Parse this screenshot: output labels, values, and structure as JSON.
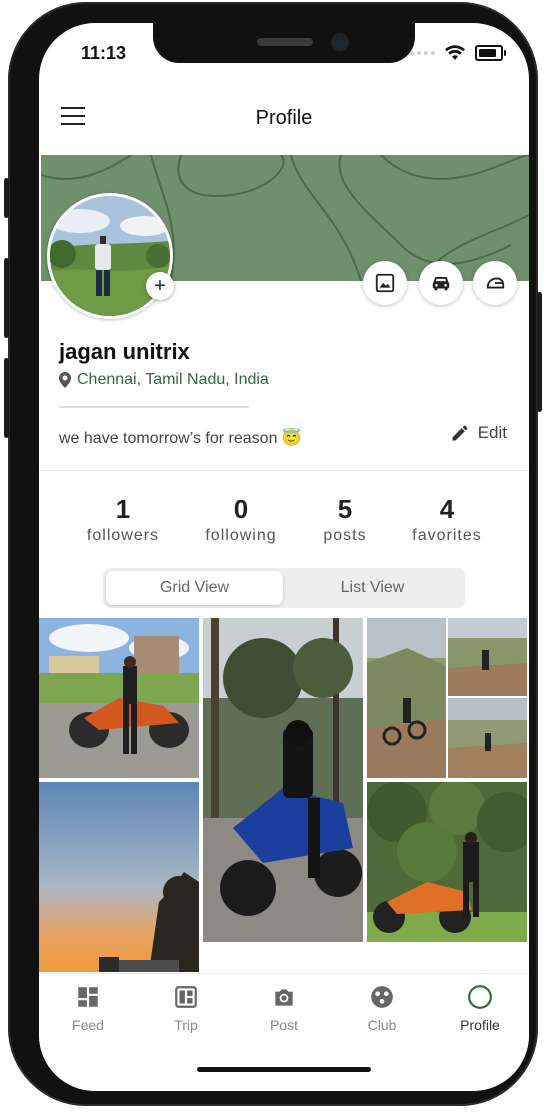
{
  "status_bar": {
    "time": "11:13",
    "battery_level": 0.85
  },
  "app_bar": {
    "title": "Profile",
    "menu_icon": "hamburger-menu-icon"
  },
  "profile": {
    "name": "jagan unitrix",
    "location": "Chennai, Tamil Nadu, India",
    "bio": "we have tomorrow’s for reason 😇",
    "edit_label": "Edit",
    "cover_color": "#6f8f6d",
    "accent_color": "#2f6b3a"
  },
  "cover_actions": [
    "photo-frame-icon",
    "car-icon",
    "helmet-icon"
  ],
  "stats": [
    {
      "value": "1",
      "label": "followers"
    },
    {
      "value": "0",
      "label": "following"
    },
    {
      "value": "5",
      "label": "posts"
    },
    {
      "value": "4",
      "label": "favorites"
    }
  ],
  "view_toggle": {
    "grid": "Grid View",
    "list": "List View",
    "selected": "Grid View"
  },
  "bottom_nav": [
    {
      "label": "Feed",
      "icon": "feed-icon"
    },
    {
      "label": "Trip",
      "icon": "trip-icon"
    },
    {
      "label": "Post",
      "icon": "camera-icon"
    },
    {
      "label": "Club",
      "icon": "club-icon"
    },
    {
      "label": "Profile",
      "icon": "profile-icon",
      "active": true
    }
  ]
}
